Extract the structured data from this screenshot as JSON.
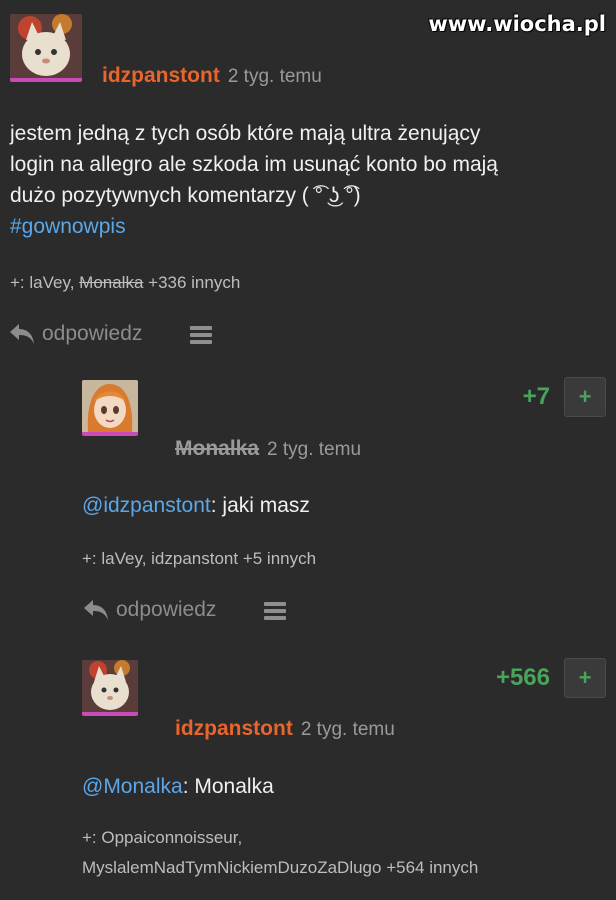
{
  "watermark": "www.wiocha.pl",
  "post": {
    "author": "idzpanstont",
    "time": "2 tyg. temu",
    "body_line1": "jestem jedną z tych osób które mają ultra żenujący",
    "body_line2": "login na allegro ale szkoda im usunąć konto bo mają",
    "body_line3": "dużo pozytywnych komentarzy ( ͡° ͜ʖ ͡°)",
    "hashtag": "#gownowpis",
    "voters_prefix": "+: ",
    "voter1": "laVey",
    "voter_sep": ", ",
    "voter2": "Monalka",
    "voters_rest": " +336 innych",
    "reply_label": "odpowiedz"
  },
  "comments": [
    {
      "vote_count": "+7",
      "plus_label": "+",
      "author": "Monalka",
      "time": "2 tyg. temu",
      "mention": "@idzpanstont",
      "text": ": jaki masz",
      "voters": "+: laVey, idzpanstont +5 innych",
      "reply_label": "odpowiedz"
    },
    {
      "vote_count": "+566",
      "plus_label": "+",
      "author": "idzpanstont",
      "time": "2 tyg. temu",
      "mention": "@Monalka",
      "text": ": Monalka",
      "voters_line1": "+: Oppaiconnoisseur,",
      "voters_line2": "MyslalemNadTymNickiemDuzoZaDlugo +564 innych"
    }
  ]
}
